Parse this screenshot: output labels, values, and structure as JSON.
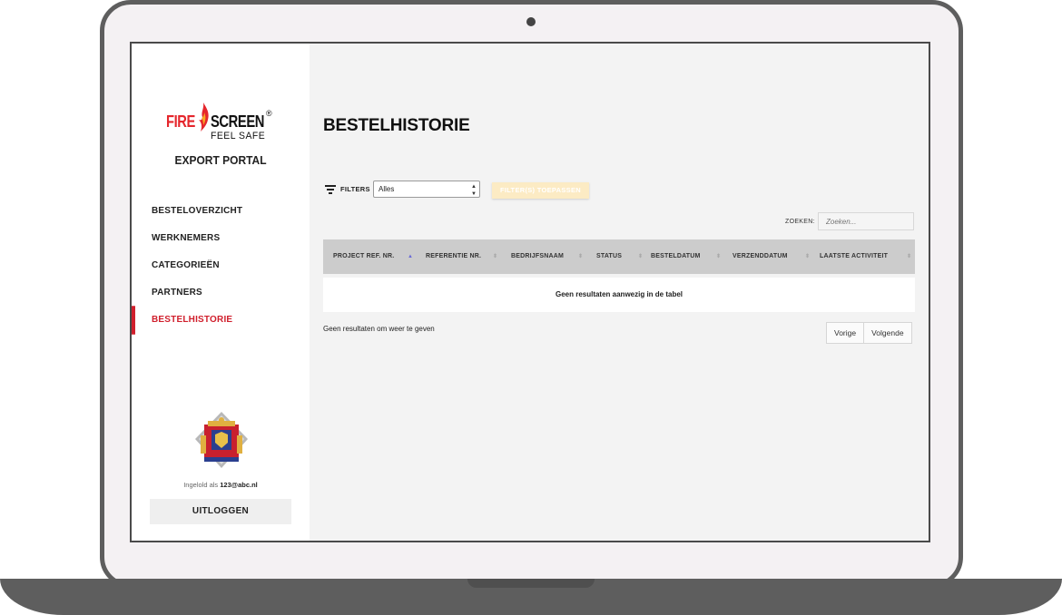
{
  "brand": {
    "fire": "FIRE",
    "screen": "SCREEN",
    "registered": "®",
    "tagline": "FEEL SAFE",
    "portal_title": "EXPORT PORTAL",
    "accent_color": "#d01f2c"
  },
  "sidebar": {
    "items": [
      {
        "label": "BESTELOVERZICHT",
        "active": false
      },
      {
        "label": "WERKNEMERS",
        "active": false
      },
      {
        "label": "CATEGORIEËN",
        "active": false
      },
      {
        "label": "PARTNERS",
        "active": false
      },
      {
        "label": "BESTELHISTORIE",
        "active": true
      }
    ],
    "logged_in_prefix": "Ingelold als",
    "logged_in_user": "123@abc.nl",
    "logout_label": "UITLOGGEN"
  },
  "main": {
    "title": "BESTELHISTORIE",
    "filters": {
      "label": "FILTERS",
      "selected": "Alles",
      "apply_label": "FILTER(S) TOEPASSEN"
    },
    "search": {
      "label": "ZOEKEN:",
      "placeholder": "Zoeken..."
    },
    "table": {
      "columns": [
        "PROJECT REF. NR.",
        "REFERENTIE NR.",
        "BEDRIJFSNAAM",
        "STATUS",
        "BESTELDATUM",
        "VERZENDDATUM",
        "LAATSTE ACTIVITEIT"
      ],
      "empty_message": "Geen resultaten aanwezig in de tabel"
    },
    "info": "Geen resultaten om weer te geven",
    "pagination": {
      "previous": "Vorige",
      "next": "Volgende"
    }
  }
}
